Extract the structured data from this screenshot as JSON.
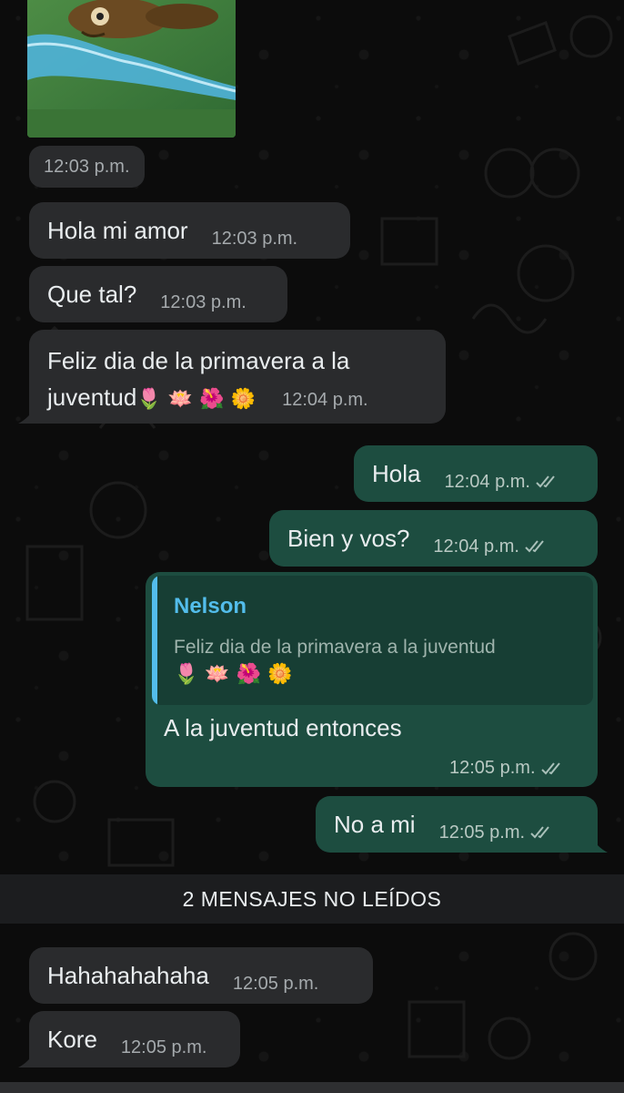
{
  "chat": {
    "media_time": "12:03 p.m.",
    "messages": [
      {
        "text": "Hola mi amor",
        "time": "12:03 p.m."
      },
      {
        "text": "Que tal?",
        "time": "12:03 p.m."
      },
      {
        "line1": "Feliz dia de la primavera a la",
        "line2": "juventud",
        "emojis": "🌷 🪷 🌺 🌼",
        "time": "12:04 p.m."
      },
      {
        "text": "Hola",
        "time": "12:04 p.m."
      },
      {
        "text": "Bien y vos?",
        "time": "12:04 p.m."
      },
      {
        "quote_name": "Nelson",
        "quote_text": "Feliz dia de la primavera a la juventud",
        "quote_emojis": "🌷 🪷 🌺 🌼",
        "text": "A la juventud entonces",
        "time": "12:05 p.m."
      },
      {
        "text": "No a mi",
        "time": "12:05 p.m."
      },
      {
        "text": "Hahahahahaha",
        "time": "12:05 p.m."
      },
      {
        "text": "Kore",
        "time": "12:05 p.m."
      }
    ],
    "unread_label": "2 MENSAJES NO LEÍDOS"
  },
  "colors": {
    "incoming_bubble": "#2a2b2d",
    "outgoing_bubble": "#1d4d40",
    "quote_accent": "#53bdeb",
    "background": "#0b0b0b"
  },
  "icons": [
    "double-check-icon",
    "bubble-tail"
  ]
}
